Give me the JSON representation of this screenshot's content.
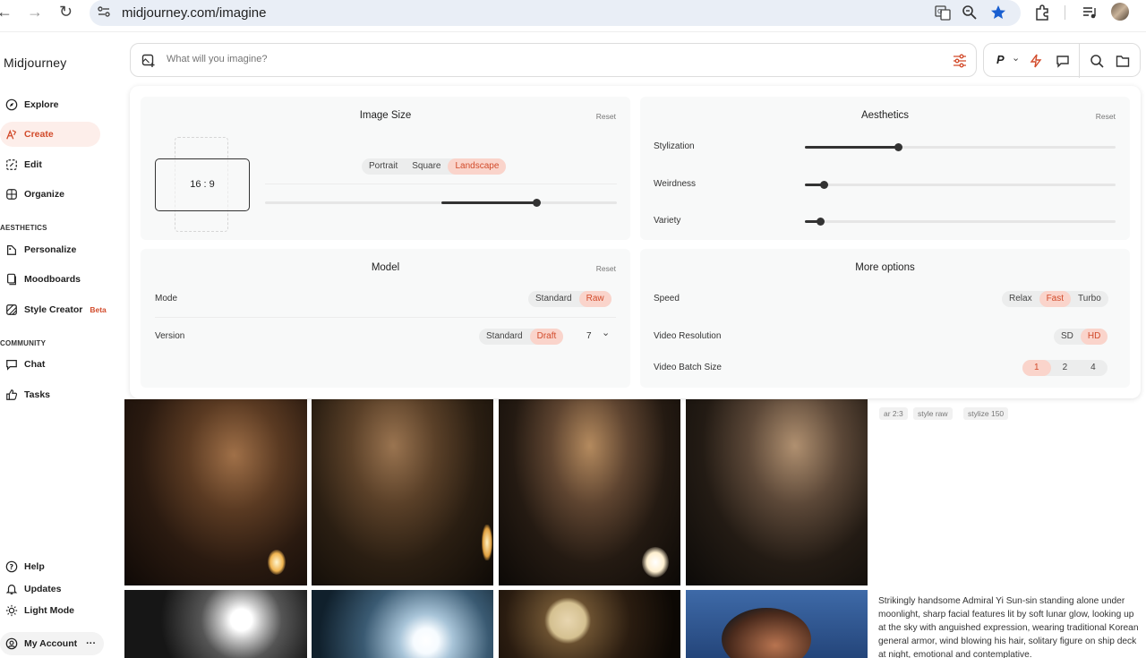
{
  "browser": {
    "url": "midjourney.com/imagine",
    "icons": [
      "back-icon",
      "forward-icon",
      "reload-icon",
      "site-settings-icon",
      "translate-icon",
      "zoom-icon",
      "bookmark-star-icon",
      "extensions-icon",
      "media-control-icon",
      "profile-avatar"
    ]
  },
  "sidebar": {
    "brand": "Midjourney",
    "items": [
      {
        "label": "Explore",
        "icon": "compass-icon"
      },
      {
        "label": "Create",
        "icon": "brush-icon",
        "active": true
      },
      {
        "label": "Edit",
        "icon": "edit-icon"
      },
      {
        "label": "Organize",
        "icon": "grid-icon"
      }
    ],
    "aesthetics_heading": "AESTHETICS",
    "aesthetics": [
      {
        "label": "Personalize",
        "icon": "personalize-icon"
      },
      {
        "label": "Moodboards",
        "icon": "moodboard-icon"
      },
      {
        "label": "Style Creator",
        "icon": "style-creator-icon",
        "badge": "Beta"
      }
    ],
    "community_heading": "COMMUNITY",
    "community": [
      {
        "label": "Chat",
        "icon": "chat-icon"
      },
      {
        "label": "Tasks",
        "icon": "thumbs-up-icon"
      }
    ],
    "bottom": [
      {
        "label": "Help",
        "icon": "help-icon"
      },
      {
        "label": "Updates",
        "icon": "bell-icon"
      },
      {
        "label": "Light Mode",
        "icon": "sun-icon"
      },
      {
        "label": "My Account",
        "icon": "account-icon"
      }
    ],
    "more": "···"
  },
  "prompt": {
    "placeholder": "What will you imagine?"
  },
  "tools": {
    "personalize": "P"
  },
  "image_size": {
    "title": "Image Size",
    "reset": "Reset",
    "ratio": "16 : 9",
    "options": [
      "Portrait",
      "Square",
      "Landscape"
    ],
    "selected": "Landscape",
    "slider_value": 0.6
  },
  "aesthetics": {
    "title": "Aesthetics",
    "reset": "Reset",
    "sliders": [
      {
        "label": "Stylization",
        "value": 0.3
      },
      {
        "label": "Weirdness",
        "value": 0.06
      },
      {
        "label": "Variety",
        "value": 0.05
      }
    ]
  },
  "model": {
    "title": "Model",
    "reset": "Reset",
    "mode_label": "Mode",
    "mode_options": [
      "Standard",
      "Raw"
    ],
    "mode_selected": "Raw",
    "version_label": "Version",
    "version_options": [
      "Standard",
      "Draft"
    ],
    "version_selected": "Draft",
    "version_number": "7"
  },
  "more_options": {
    "title": "More options",
    "speed_label": "Speed",
    "speed_options": [
      "Relax",
      "Fast",
      "Turbo"
    ],
    "speed_selected": "Fast",
    "res_label": "Video Resolution",
    "res_options": [
      "SD",
      "HD"
    ],
    "res_selected": "HD",
    "batch_label": "Video Batch Size",
    "batch_options": [
      "1",
      "2",
      "4"
    ],
    "batch_selected": "1"
  },
  "job_tags": [
    "ar 2:3",
    "style raw",
    "stylize 150"
  ],
  "job_description": "Strikingly handsome Admiral Yi Sun-sin standing alone under moonlight, sharp facial features lit by soft lunar glow, looking up at the sky with anguished expression, wearing traditional Korean general armor, wind blowing his hair, solitary figure on ship deck at night, emotional and contemplative."
}
